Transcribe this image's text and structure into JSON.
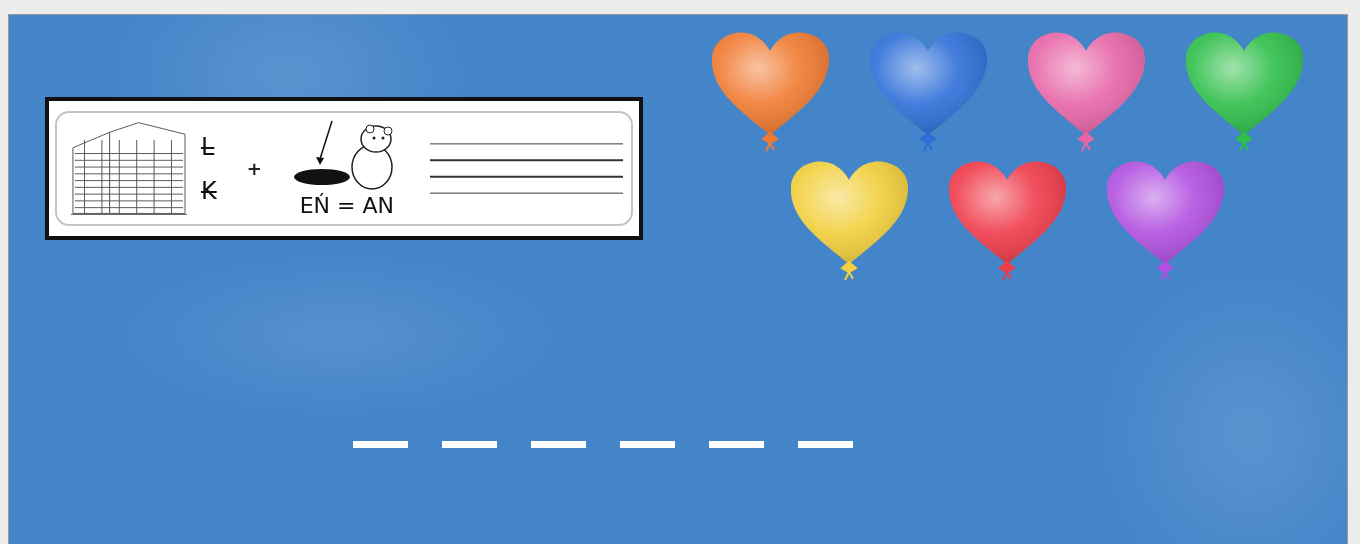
{
  "rebus": {
    "crossed_letters": [
      {
        "letter": "L",
        "crossed": true
      },
      {
        "letter": "K",
        "crossed": true
      }
    ],
    "plus": "+",
    "rule": "EŃ = AN"
  },
  "balloons": [
    {
      "color": "#f07a30"
    },
    {
      "color": "#2f6fd8"
    },
    {
      "color": "#e766a8"
    },
    {
      "color": "#2fbf4a"
    },
    {
      "color": "#f2cf3c"
    },
    {
      "color": "#ef3b4a"
    },
    {
      "color": "#b04fe0"
    }
  ],
  "answer_slots": [
    {
      "kind": "blank"
    },
    {
      "kind": "blank"
    },
    {
      "kind": "blank"
    },
    {
      "kind": "blank"
    },
    {
      "kind": "blank"
    },
    {
      "kind": "blank"
    }
  ]
}
